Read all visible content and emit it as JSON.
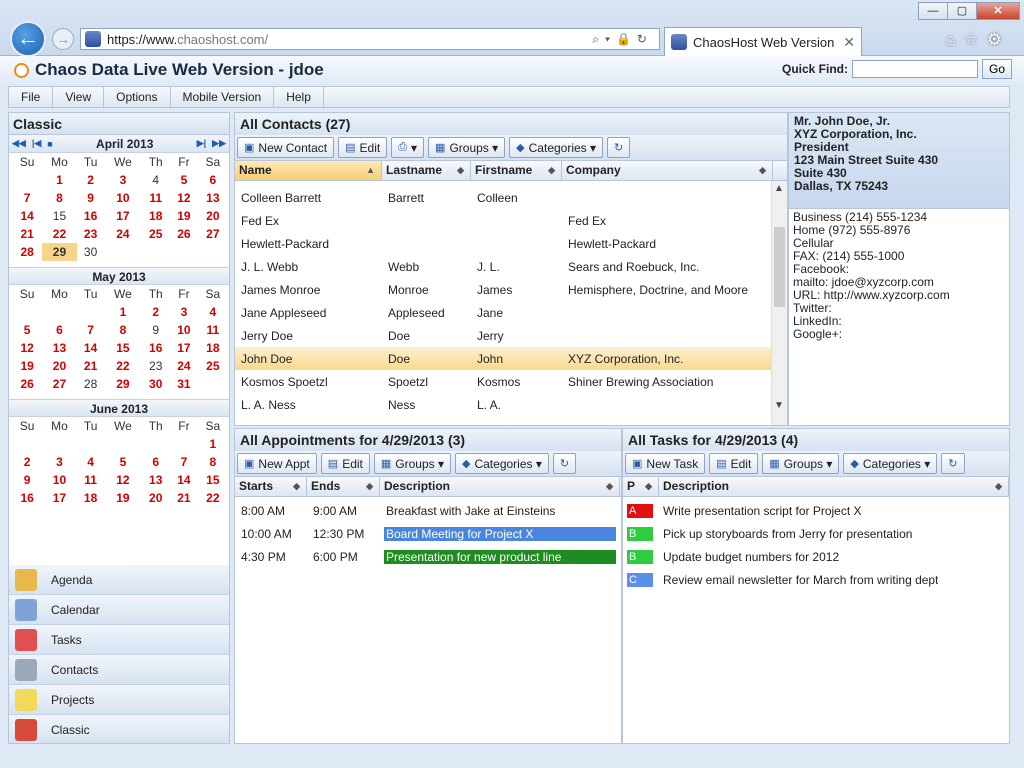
{
  "browser": {
    "url_prefix": "https://www.",
    "url_domain": "chaoshost.com/",
    "tab_title": "ChaosHost Web Version",
    "window_controls": [
      "—",
      "▢",
      "✕"
    ]
  },
  "app": {
    "title": "Chaos Data Live Web Version - jdoe",
    "quick_find_label": "Quick Find:",
    "quick_find_value": "",
    "go_label": "Go"
  },
  "menu": [
    "File",
    "View",
    "Options",
    "Mobile Version",
    "Help"
  ],
  "left": {
    "title": "Classic",
    "weekdays": [
      "Su",
      "Mo",
      "Tu",
      "We",
      "Th",
      "Fr",
      "Sa"
    ],
    "april": {
      "title": "April 2013",
      "rows": [
        [
          "",
          "1",
          "2",
          "3",
          "4",
          "5",
          "6"
        ],
        [
          "7",
          "8",
          "9",
          "10",
          "11",
          "12",
          "13"
        ],
        [
          "14",
          "15",
          "16",
          "17",
          "18",
          "19",
          "20"
        ],
        [
          "21",
          "22",
          "23",
          "24",
          "25",
          "26",
          "27"
        ],
        [
          "28",
          "29",
          "30",
          "",
          "",
          "",
          ""
        ]
      ],
      "selected": "29",
      "plain": [
        "4",
        "15",
        "30"
      ]
    },
    "may": {
      "title": "May 2013",
      "rows": [
        [
          "",
          "",
          "",
          "1",
          "2",
          "3",
          "4"
        ],
        [
          "5",
          "6",
          "7",
          "8",
          "9",
          "10",
          "11"
        ],
        [
          "12",
          "13",
          "14",
          "15",
          "16",
          "17",
          "18"
        ],
        [
          "19",
          "20",
          "21",
          "22",
          "23",
          "24",
          "25"
        ],
        [
          "26",
          "27",
          "28",
          "29",
          "30",
          "31",
          ""
        ]
      ],
      "plain": [
        "9",
        "23",
        "28"
      ]
    },
    "june": {
      "title": "June 2013",
      "rows": [
        [
          "",
          "",
          "",
          "",
          "",
          "",
          "1"
        ],
        [
          "2",
          "3",
          "4",
          "5",
          "6",
          "7",
          "8"
        ],
        [
          "9",
          "10",
          "11",
          "12",
          "13",
          "14",
          "15"
        ],
        [
          "16",
          "17",
          "18",
          "19",
          "20",
          "21",
          "22"
        ]
      ],
      "plain": []
    },
    "nav": [
      {
        "label": "Agenda",
        "icon": "house-icon",
        "color": "#e8b84a"
      },
      {
        "label": "Calendar",
        "icon": "calendar-icon",
        "color": "#7ea3d8"
      },
      {
        "label": "Tasks",
        "icon": "checklist-icon",
        "color": "#e05050"
      },
      {
        "label": "Contacts",
        "icon": "contact-card-icon",
        "color": "#9aa8b8"
      },
      {
        "label": "Projects",
        "icon": "sticky-note-icon",
        "color": "#f2d95a"
      },
      {
        "label": "Classic",
        "icon": "classic-grid-icon",
        "color": "#d84a3a"
      }
    ]
  },
  "contacts": {
    "title": "All Contacts (27)",
    "buttons": [
      "New Contact",
      "Edit",
      "Groups",
      "Categories"
    ],
    "columns": [
      "Name",
      "Lastname",
      "Firstname",
      "Company"
    ],
    "rows": [
      [
        "Colleen Barrett",
        "Barrett",
        "Colleen",
        ""
      ],
      [
        "Fed Ex",
        "",
        "",
        "Fed Ex"
      ],
      [
        "Hewlett-Packard",
        "",
        "",
        "Hewlett-Packard"
      ],
      [
        "J. L. Webb",
        "Webb",
        "J. L.",
        "Sears and Roebuck, Inc."
      ],
      [
        "James Monroe",
        "Monroe",
        "James",
        "Hemisphere, Doctrine, and Moore"
      ],
      [
        "Jane Appleseed",
        "Appleseed",
        "Jane",
        ""
      ],
      [
        "Jerry Doe",
        "Doe",
        "Jerry",
        ""
      ],
      [
        "John Doe",
        "Doe",
        "John",
        "XYZ Corporation, Inc."
      ],
      [
        "Kosmos Spoetzl",
        "Spoetzl",
        "Kosmos",
        "Shiner Brewing Association"
      ],
      [
        "L. A. Ness",
        "Ness",
        "L. A.",
        ""
      ]
    ],
    "selected_index": 7
  },
  "detail": {
    "head": [
      "Mr. John Doe, Jr.",
      "XYZ Corporation, Inc.",
      "President",
      "123 Main Street Suite 430",
      "Suite 430",
      "Dallas, TX 75243"
    ],
    "body": [
      "Business (214) 555-1234",
      "Home (972) 555-8976",
      "Cellular",
      "FAX: (214) 555-1000",
      "Facebook:",
      "mailto: jdoe@xyzcorp.com",
      "URL: http://www.xyzcorp.com",
      "Twitter:",
      "LinkedIn:",
      "Google+:"
    ]
  },
  "appointments": {
    "title": "All Appointments for 4/29/2013 (3)",
    "buttons": [
      "New Appt",
      "Edit",
      "Groups",
      "Categories"
    ],
    "columns": [
      "Starts",
      "Ends",
      "Description"
    ],
    "rows": [
      {
        "start": "8:00 AM",
        "end": "9:00 AM",
        "desc": "Breakfast with Jake at Einsteins",
        "color": ""
      },
      {
        "start": "10:00 AM",
        "end": "12:30 PM",
        "desc": "Board Meeting for Project X",
        "color": "#4a86e0"
      },
      {
        "start": "4:30 PM",
        "end": "6:00 PM",
        "desc": "Presentation for new product line",
        "color": "#1e8c1e"
      }
    ]
  },
  "tasks": {
    "title": "All Tasks for 4/29/2013 (4)",
    "buttons": [
      "New Task",
      "Edit",
      "Groups",
      "Categories"
    ],
    "columns": [
      "P",
      "Description"
    ],
    "rows": [
      {
        "p": "A",
        "desc": "Write presentation script for Project X",
        "color": "#e01010"
      },
      {
        "p": "B",
        "desc": "Pick up storyboards from Jerry for presentation",
        "color": "#2ecc40"
      },
      {
        "p": "B",
        "desc": "Update budget numbers for 2012",
        "color": "#2ecc40"
      },
      {
        "p": "C",
        "desc": "Review email newsletter for March from writing dept",
        "color": "#5b8fe8"
      }
    ]
  }
}
